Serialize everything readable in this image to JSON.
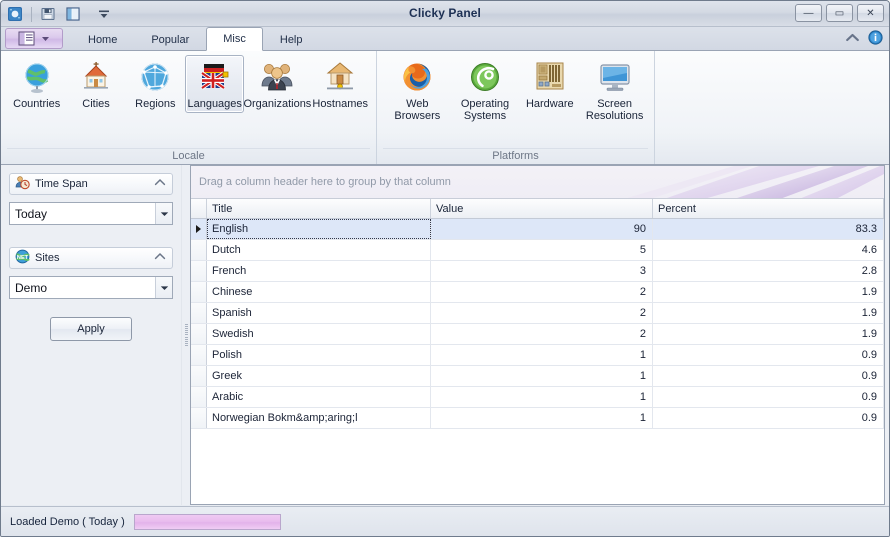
{
  "window": {
    "title": "Clicky Panel",
    "controls": [
      {
        "name": "minimize",
        "glyph": "—"
      },
      {
        "name": "maximize",
        "glyph": "▭"
      },
      {
        "name": "close",
        "glyph": "✕"
      }
    ]
  },
  "quick_access": [
    {
      "name": "app-logo-icon",
      "label": "Clicky"
    },
    {
      "name": "save-icon",
      "label": "Save"
    },
    {
      "name": "panel-icon",
      "label": "Panel"
    },
    {
      "name": "customize-qat-icon",
      "label": "Customize Quick Access Toolbar"
    }
  ],
  "appmenu": {
    "name": "application-menu-button",
    "label": "Menu"
  },
  "tabs": [
    {
      "label": "Home",
      "active": false
    },
    {
      "label": "Popular",
      "active": false
    },
    {
      "label": "Misc",
      "active": true
    },
    {
      "label": "Help",
      "active": false
    }
  ],
  "tab_right_icons": [
    {
      "name": "minimize-ribbon-icon",
      "label": "Minimize the Ribbon"
    },
    {
      "name": "help-info-icon",
      "label": "Help"
    }
  ],
  "ribbon": {
    "groups": [
      {
        "label": "Locale",
        "items": [
          {
            "label": "Countries",
            "icon": "globe-icon",
            "selected": false
          },
          {
            "label": "Cities",
            "icon": "church-icon",
            "selected": false
          },
          {
            "label": "Regions",
            "icon": "network-globe-icon",
            "selected": false
          },
          {
            "label": "Languages",
            "icon": "flags-icon",
            "selected": true
          },
          {
            "label": "Organizations",
            "icon": "people-icon",
            "selected": false
          },
          {
            "label": "Hostnames",
            "icon": "house-icon",
            "selected": false
          }
        ]
      },
      {
        "label": "Platforms",
        "items": [
          {
            "label": "Web Browsers",
            "icon": "firefox-icon",
            "selected": false
          },
          {
            "label": "Operating Systems",
            "icon": "opensuse-icon",
            "selected": false
          },
          {
            "label": "Hardware",
            "icon": "motherboard-icon",
            "selected": false
          },
          {
            "label": "Screen Resolutions",
            "icon": "monitor-icon",
            "selected": false
          }
        ]
      }
    ]
  },
  "sidebar": {
    "timespan": {
      "header": "Time Span",
      "icon": "user-clock-icon",
      "collapse_glyph": "⌃",
      "value": "Today"
    },
    "sites": {
      "header": "Sites",
      "icon": "net-globe-icon",
      "collapse_glyph": "⌃",
      "value": "Demo"
    },
    "apply_label": "Apply"
  },
  "grid": {
    "group_hint": "Drag a column header here to group by that column",
    "columns": [
      "Title",
      "Value",
      "Percent"
    ],
    "rows": [
      {
        "title": "English",
        "value": "90",
        "percent": "83.3",
        "selected": true
      },
      {
        "title": "Dutch",
        "value": "5",
        "percent": "4.6",
        "selected": false
      },
      {
        "title": "French",
        "value": "3",
        "percent": "2.8",
        "selected": false
      },
      {
        "title": "Chinese",
        "value": "2",
        "percent": "1.9",
        "selected": false
      },
      {
        "title": "Spanish",
        "value": "2",
        "percent": "1.9",
        "selected": false
      },
      {
        "title": "Swedish",
        "value": "2",
        "percent": "1.9",
        "selected": false
      },
      {
        "title": "Polish",
        "value": "1",
        "percent": "0.9",
        "selected": false
      },
      {
        "title": "Greek",
        "value": "1",
        "percent": "0.9",
        "selected": false
      },
      {
        "title": "Arabic",
        "value": "1",
        "percent": "0.9",
        "selected": false
      },
      {
        "title": "Norwegian Bokm&amp;aring;l",
        "value": "1",
        "percent": "0.9",
        "selected": false
      }
    ]
  },
  "statusbar": {
    "text": "Loaded Demo ( Today )",
    "progress_label": "progress"
  },
  "colors": {
    "accent_purple": "#c9a9dd",
    "selection_blue": "#dde7f8",
    "chrome": "#dfe4ec"
  }
}
